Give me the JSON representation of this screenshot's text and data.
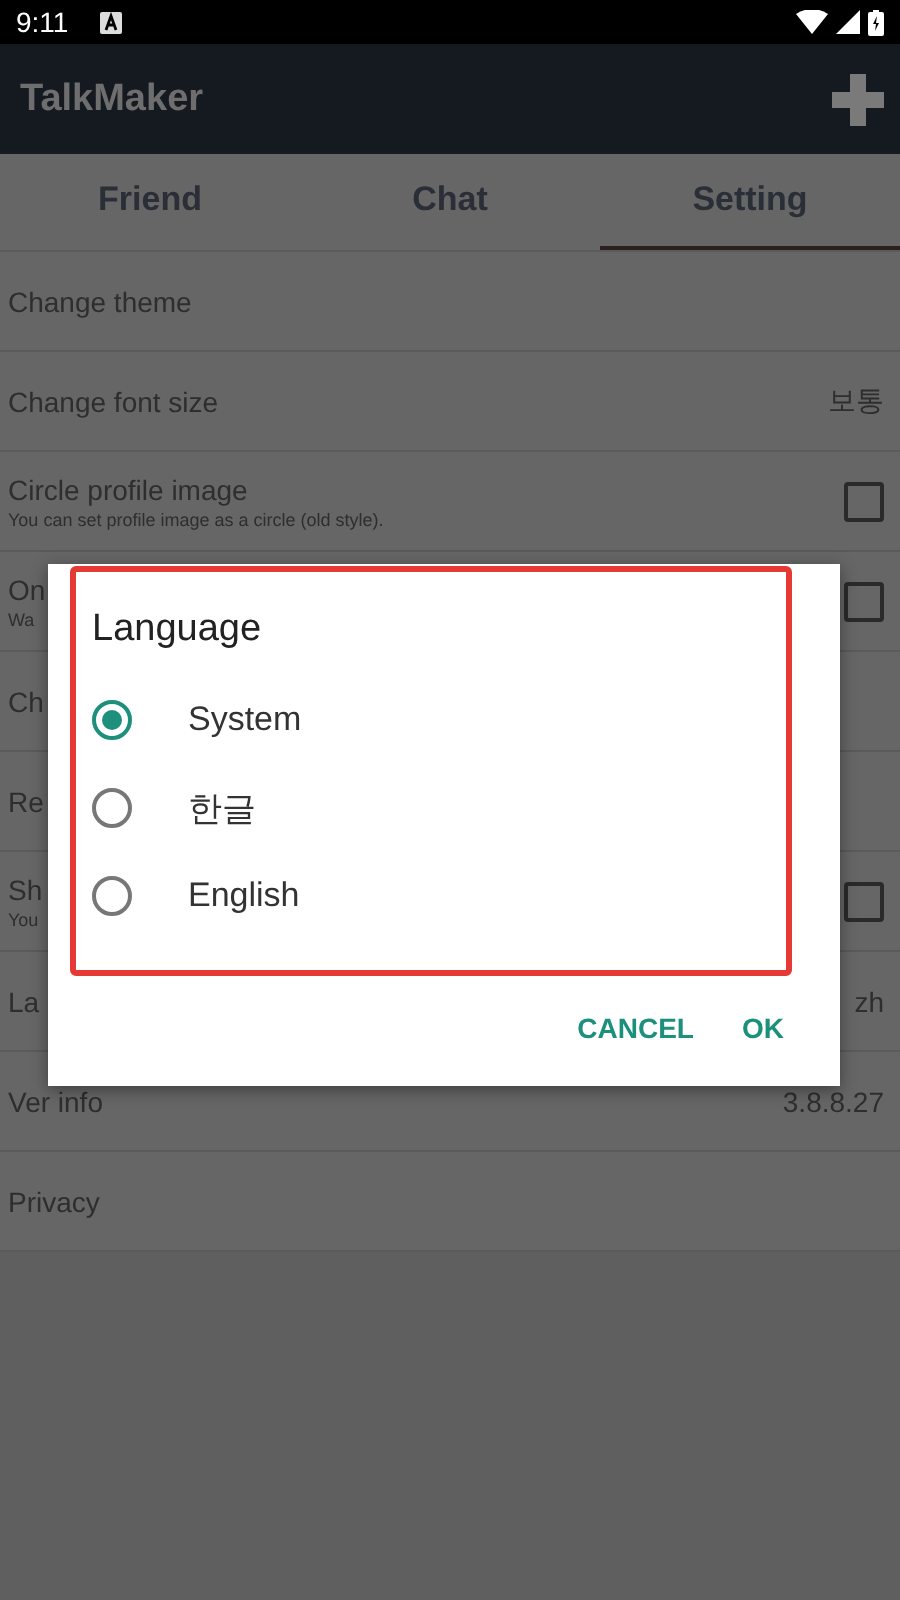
{
  "status_bar": {
    "time": "9:11"
  },
  "app_bar": {
    "title": "TalkMaker"
  },
  "tabs": [
    {
      "label": "Friend",
      "selected": false
    },
    {
      "label": "Chat",
      "selected": false
    },
    {
      "label": "Setting",
      "selected": true
    }
  ],
  "settings": [
    {
      "kind": "text",
      "title": "Change theme"
    },
    {
      "kind": "value",
      "title": "Change font size",
      "value": "보통"
    },
    {
      "kind": "check",
      "title": "Circle profile image",
      "subtitle": "You can set profile image as a circle (old style).",
      "checked": false
    },
    {
      "kind": "check",
      "title": "On",
      "subtitle": "Wa",
      "checked": false
    },
    {
      "kind": "text",
      "title": "Ch"
    },
    {
      "kind": "text",
      "title": "Re"
    },
    {
      "kind": "check",
      "title": "Sh",
      "subtitle": "You",
      "checked": false
    },
    {
      "kind": "value",
      "title": "La",
      "value": "zh"
    },
    {
      "kind": "value",
      "title": "Ver info",
      "value": "3.8.8.27"
    },
    {
      "kind": "text",
      "title": "Privacy"
    }
  ],
  "dialog": {
    "title": "Language",
    "options": [
      {
        "label": "System",
        "selected": true
      },
      {
        "label": "한글",
        "selected": false
      },
      {
        "label": "English",
        "selected": false
      }
    ],
    "buttons": [
      "CANCEL",
      "OK"
    ]
  }
}
